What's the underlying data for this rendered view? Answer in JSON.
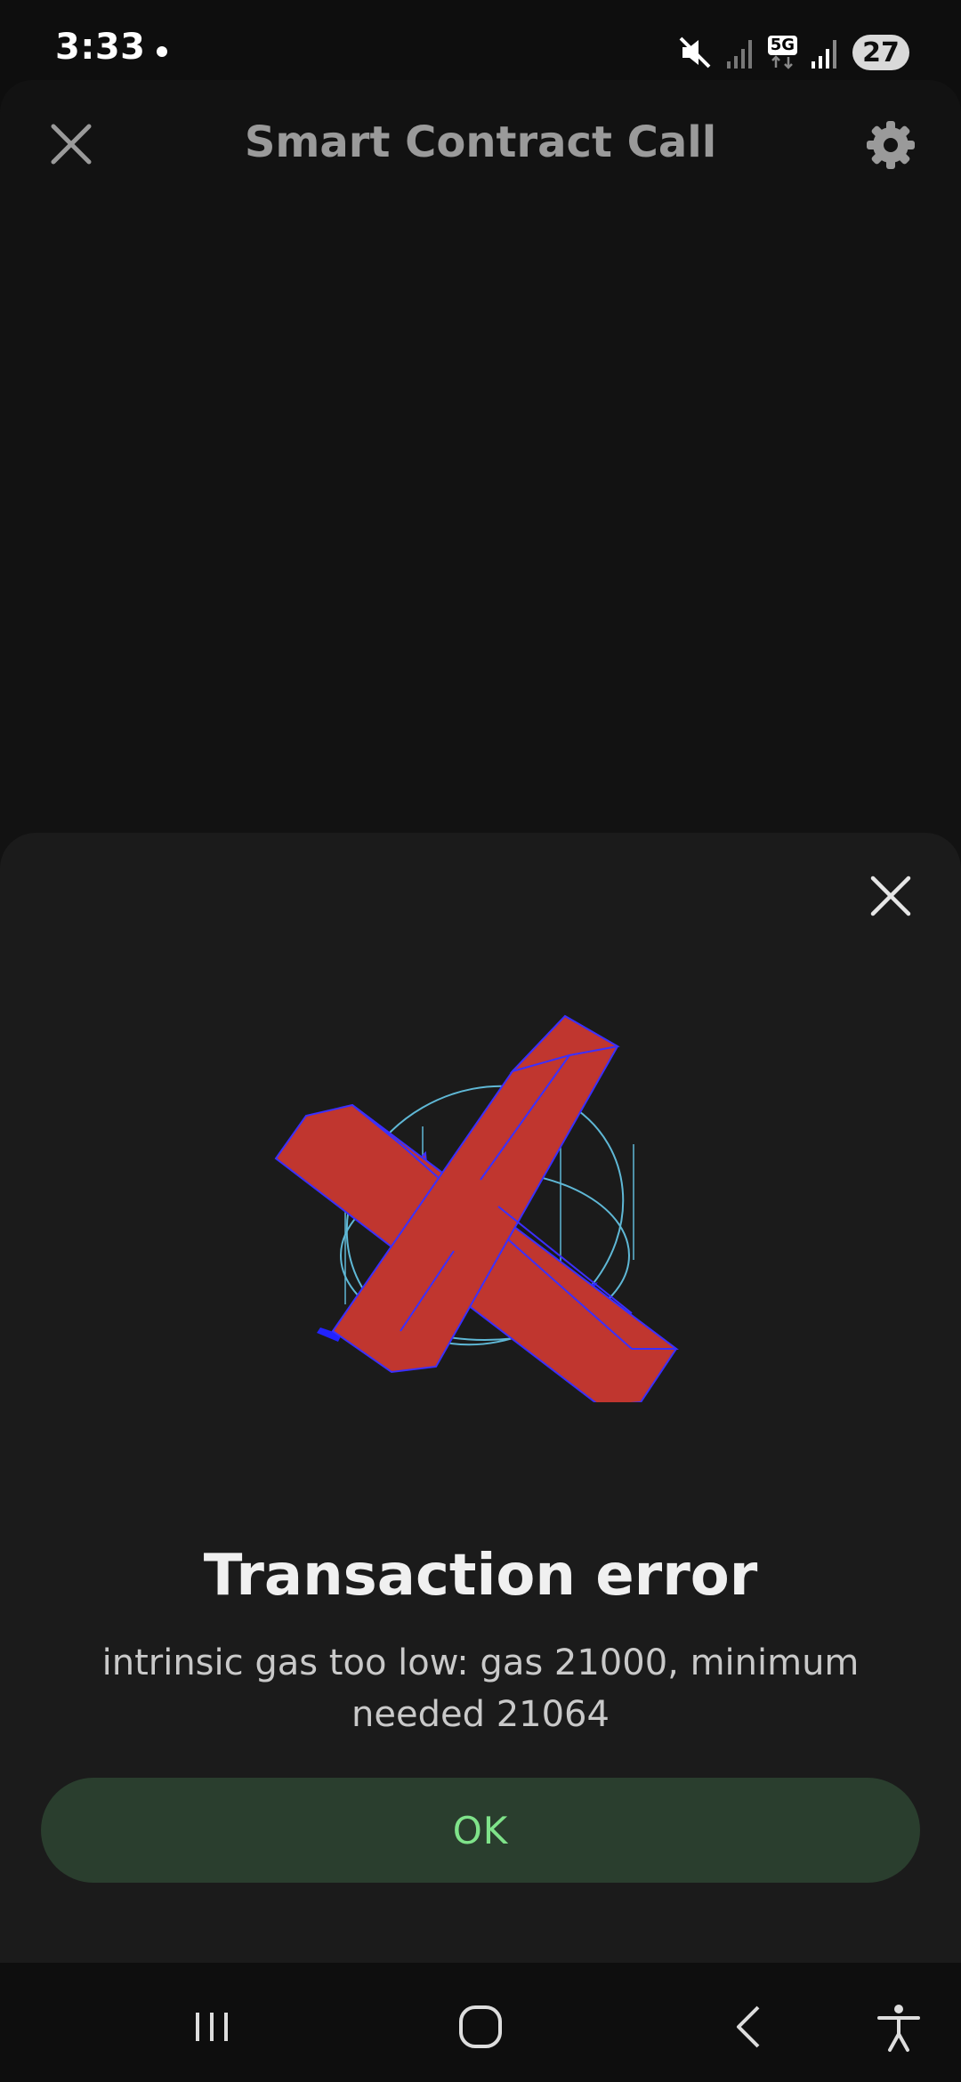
{
  "status_bar": {
    "time": "3:33",
    "network": "5G",
    "battery": "27"
  },
  "header": {
    "title": "Smart Contract Call",
    "close_icon": "close-icon",
    "settings_icon": "gear-icon"
  },
  "dialog": {
    "close_icon": "close-icon",
    "illustration_icon": "error-x-icon",
    "title": "Transaction error",
    "message": "intrinsic gas too low: gas 21000, minimum needed 21064",
    "ok_label": "OK"
  },
  "nav_bar": {
    "icons": [
      "recents-icon",
      "home-icon",
      "back-icon",
      "accessibility-icon"
    ]
  },
  "colors": {
    "accent_green": "#7fe38a",
    "button_bg": "#2a3e2e",
    "error_red": "#c0362f"
  }
}
